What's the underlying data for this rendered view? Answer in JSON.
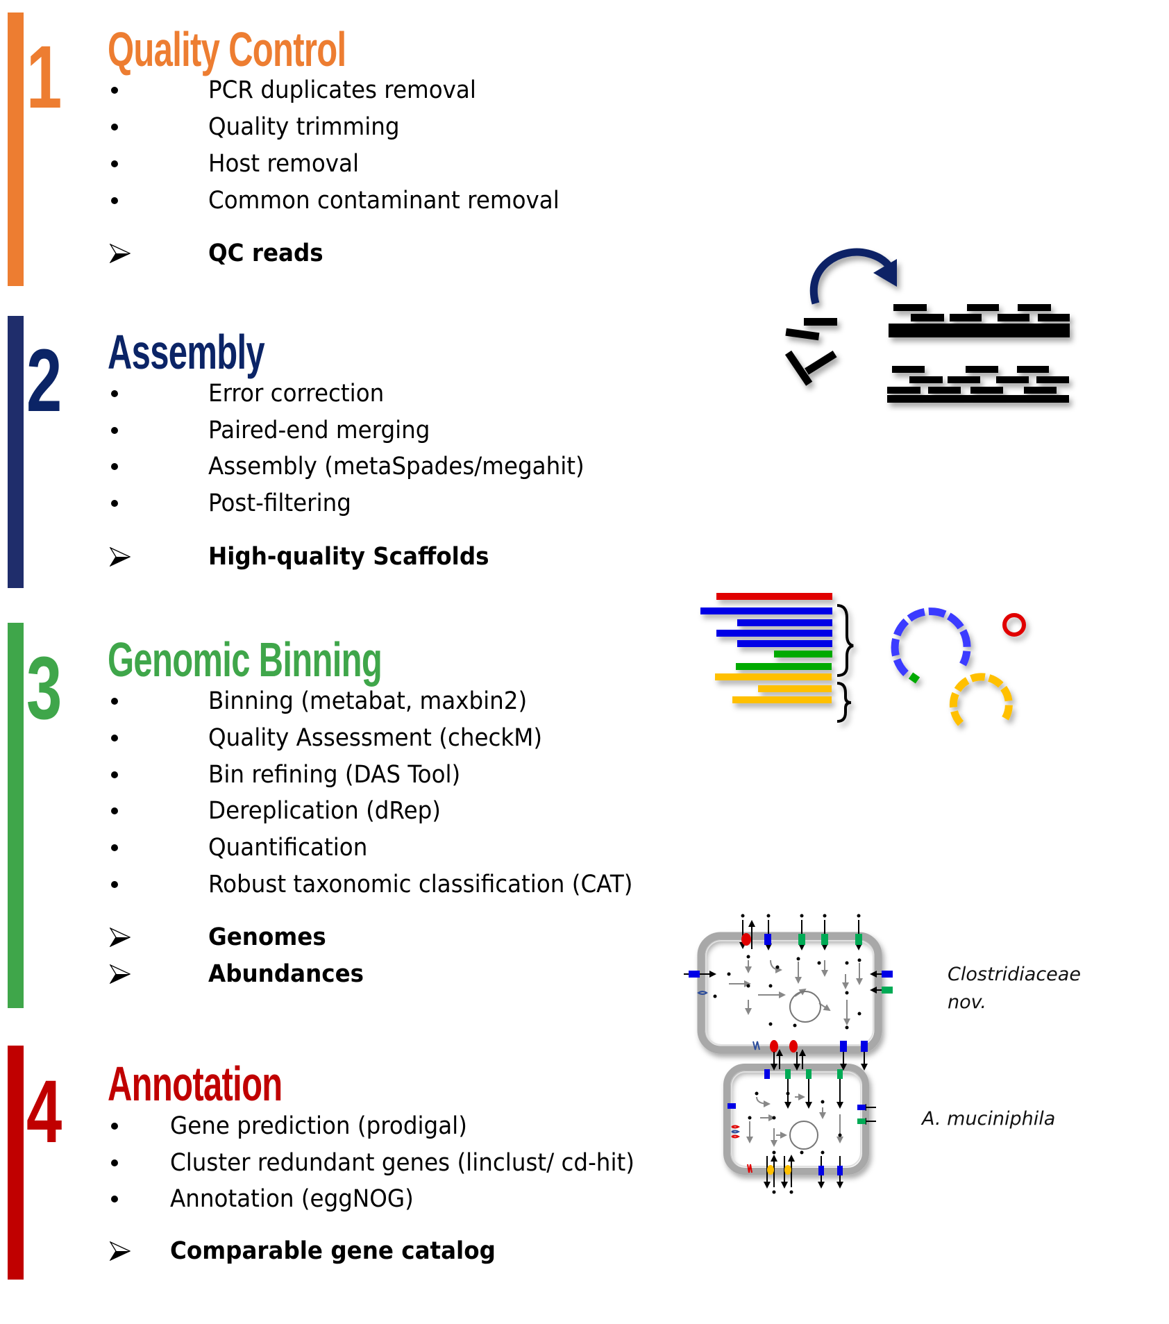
{
  "colors": {
    "quality_control": "#ED7D31",
    "assembly": "#1F2D6B",
    "binning": "#3FA64A",
    "annotation": "#C00000",
    "contig_red": "#E00000",
    "contig_blue": "#0000E6",
    "contig_green": "#00AA00",
    "contig_yellow": "#FFC000",
    "arrow_navy": "#0B2466"
  },
  "sections": [
    {
      "number": "1",
      "title": "Quality Control",
      "steps": [
        "PCR duplicates removal",
        "Quality trimming",
        "Host removal",
        "Common contaminant removal"
      ],
      "outputs": [
        "QC reads"
      ]
    },
    {
      "number": "2",
      "title": "Assembly",
      "steps": [
        "Error correction",
        "Paired-end merging",
        "Assembly (metaSpades/megahit)",
        "Post-filtering"
      ],
      "outputs": [
        "High-quality Scaffolds"
      ]
    },
    {
      "number": "3",
      "title": "Genomic Binning",
      "steps": [
        "Binning (metabat, maxbin2)",
        "Quality Assessment (checkM)",
        "Bin refining (DAS Tool)",
        "Dereplication (dRep)",
        "Quantification",
        "Robust taxonomic classification (CAT)"
      ],
      "outputs": [
        "Genomes",
        "Abundances"
      ]
    },
    {
      "number": "4",
      "title": "Annotation",
      "steps": [
        "Gene prediction (prodigal)",
        "Cluster redundant genes (linclust/ cd-hit)",
        "Annotation (eggNOG)"
      ],
      "outputs": [
        "Comparable gene catalog"
      ]
    }
  ],
  "figures": {
    "assembly_icon": "read-assembly-icon",
    "binning_icon": "contig-binning-icon",
    "metabolic_icon": "metabolic-network-icon",
    "organism_labels": [
      "Clostridiaceae",
      "nov.",
      "A. muciniphila"
    ]
  }
}
